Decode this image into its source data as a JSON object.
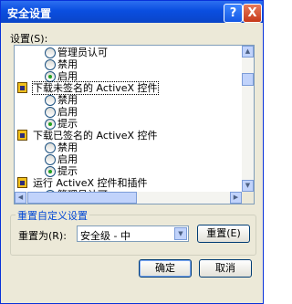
{
  "window": {
    "title": "安全设置",
    "help_symbol": "?",
    "close_symbol": "X"
  },
  "settings": {
    "label": "设置(S):",
    "rows": [
      {
        "kind": "option",
        "label": "管理员认可",
        "checked": false
      },
      {
        "kind": "option",
        "label": "禁用",
        "checked": false
      },
      {
        "kind": "option",
        "label": "启用",
        "checked": true
      },
      {
        "kind": "category",
        "label": "下载未签名的 ActiveX 控件",
        "focused": true
      },
      {
        "kind": "option",
        "label": "禁用",
        "checked": false
      },
      {
        "kind": "option",
        "label": "启用",
        "checked": false
      },
      {
        "kind": "option",
        "label": "提示",
        "checked": true
      },
      {
        "kind": "category",
        "label": "下载已签名的 ActiveX 控件",
        "focused": false
      },
      {
        "kind": "option",
        "label": "禁用",
        "checked": false
      },
      {
        "kind": "option",
        "label": "启用",
        "checked": false
      },
      {
        "kind": "option",
        "label": "提示",
        "checked": true
      },
      {
        "kind": "category",
        "label": "运行 ActiveX 控件和插件",
        "focused": false
      },
      {
        "kind": "option",
        "label": "管理员认可",
        "checked": false
      }
    ]
  },
  "reset_group": {
    "title": "重置自定义设置",
    "reset_to_label": "重置为(R):",
    "selected_level": "安全级 - 中",
    "reset_button": "重置(E)"
  },
  "footer": {
    "ok_button": "确定",
    "cancel_button": "取消"
  }
}
